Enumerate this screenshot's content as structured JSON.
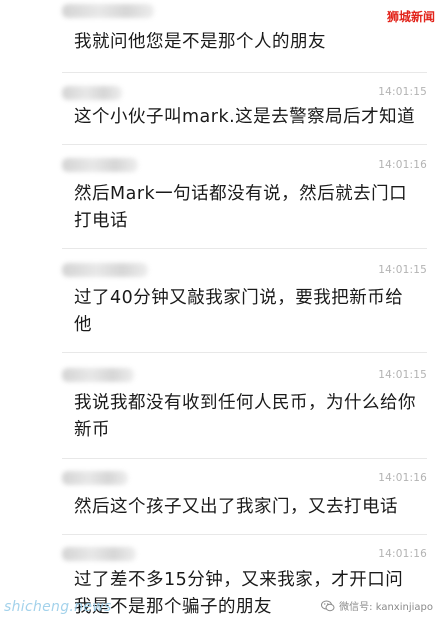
{
  "brand": {
    "label": "狮城新闻"
  },
  "messages": [
    {
      "time": "",
      "text": "我就问他您是不是那个人的朋友"
    },
    {
      "time": "14:01:15",
      "text": "这个小伙子叫mark.这是去警察局后才知道"
    },
    {
      "time": "14:01:16",
      "text": "然后Mark一句话都没有说，然后就去门口打电话"
    },
    {
      "time": "14:01:15",
      "text": "过了40分钟又敲我家门说，要我把新币给他"
    },
    {
      "time": "14:01:15",
      "text": "我说我都没有收到任何人民币，为什么给你新币"
    },
    {
      "time": "14:01:16",
      "text": "然后这个孩子又出了我家门，又去打电话"
    },
    {
      "time": "14:01:16",
      "text": "过了差不多15分钟，又来我家，才开口问我是不是那个骗子的朋友"
    }
  ],
  "watermark": {
    "left": "shicheng.news",
    "right": "微信号: kanxinjiapo",
    "icon": "wechat-icon"
  }
}
